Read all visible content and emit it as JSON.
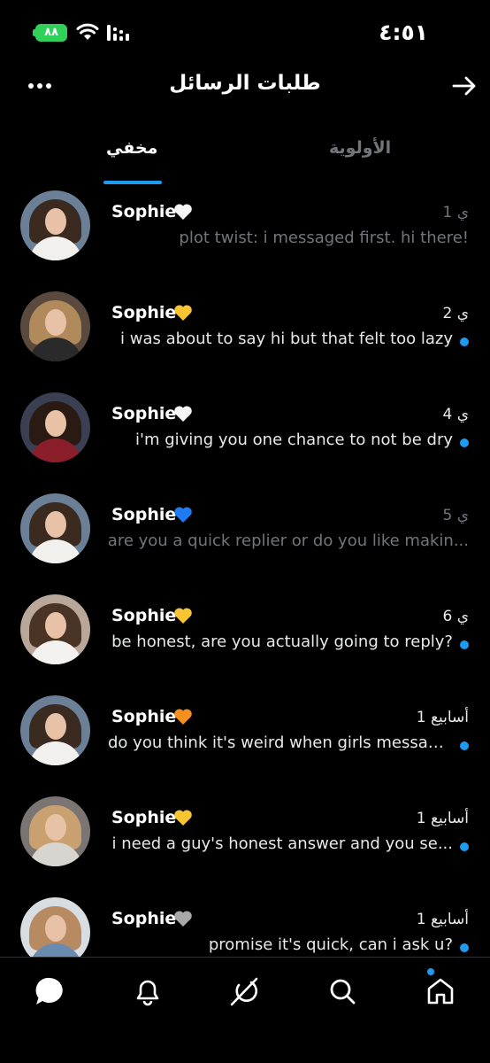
{
  "status": {
    "battery": "٨٨",
    "time": "٤:٥١"
  },
  "header": {
    "title": "طلبات الرسائل"
  },
  "tabs": {
    "hidden": "مخفي",
    "priority": "الأولوية"
  },
  "colors": {
    "accent": "#1d9bf0",
    "muted": "#71767b"
  },
  "messages": [
    {
      "name": "Sophie",
      "heart": "white-heart-icon",
      "time": "1 ي",
      "text": "plot twist: i messaged first. hi there!",
      "unread": false
    },
    {
      "name": "Sophie",
      "heart": "yellow-heart-icon",
      "time": "2 ي",
      "text": "i was about to say hi but that felt too lazy",
      "unread": true
    },
    {
      "name": "Sophie",
      "heart": "white-heart-icon",
      "time": "4 ي",
      "text": "i'm giving you one chance to not be dry",
      "unread": true
    },
    {
      "name": "Sophie",
      "heart": "blue-heart-icon",
      "time": "5 ي",
      "text": "are you a quick replier or do you like makin...",
      "unread": false
    },
    {
      "name": "Sophie",
      "heart": "yellow-heart-icon",
      "time": "6 ي",
      "text": "be honest, are you actually going to reply?",
      "unread": true
    },
    {
      "name": "Sophie",
      "heart": "orange-heart-icon",
      "time": "1 أسابيع",
      "text": "do you think it's weird when girls messag...",
      "unread": true
    },
    {
      "name": "Sophie",
      "heart": "yellow-heart-icon",
      "time": "1 أسابيع",
      "text": "i need a guy's honest answer and you se...",
      "unread": true
    },
    {
      "name": "Sophie",
      "heart": "grey-heart-icon",
      "time": "1 أسابيع",
      "text": "promise it's quick, can i ask u?",
      "unread": true
    }
  ],
  "nav": [
    "messages-icon",
    "notifications-icon",
    "grok-icon",
    "search-icon",
    "home-icon"
  ]
}
